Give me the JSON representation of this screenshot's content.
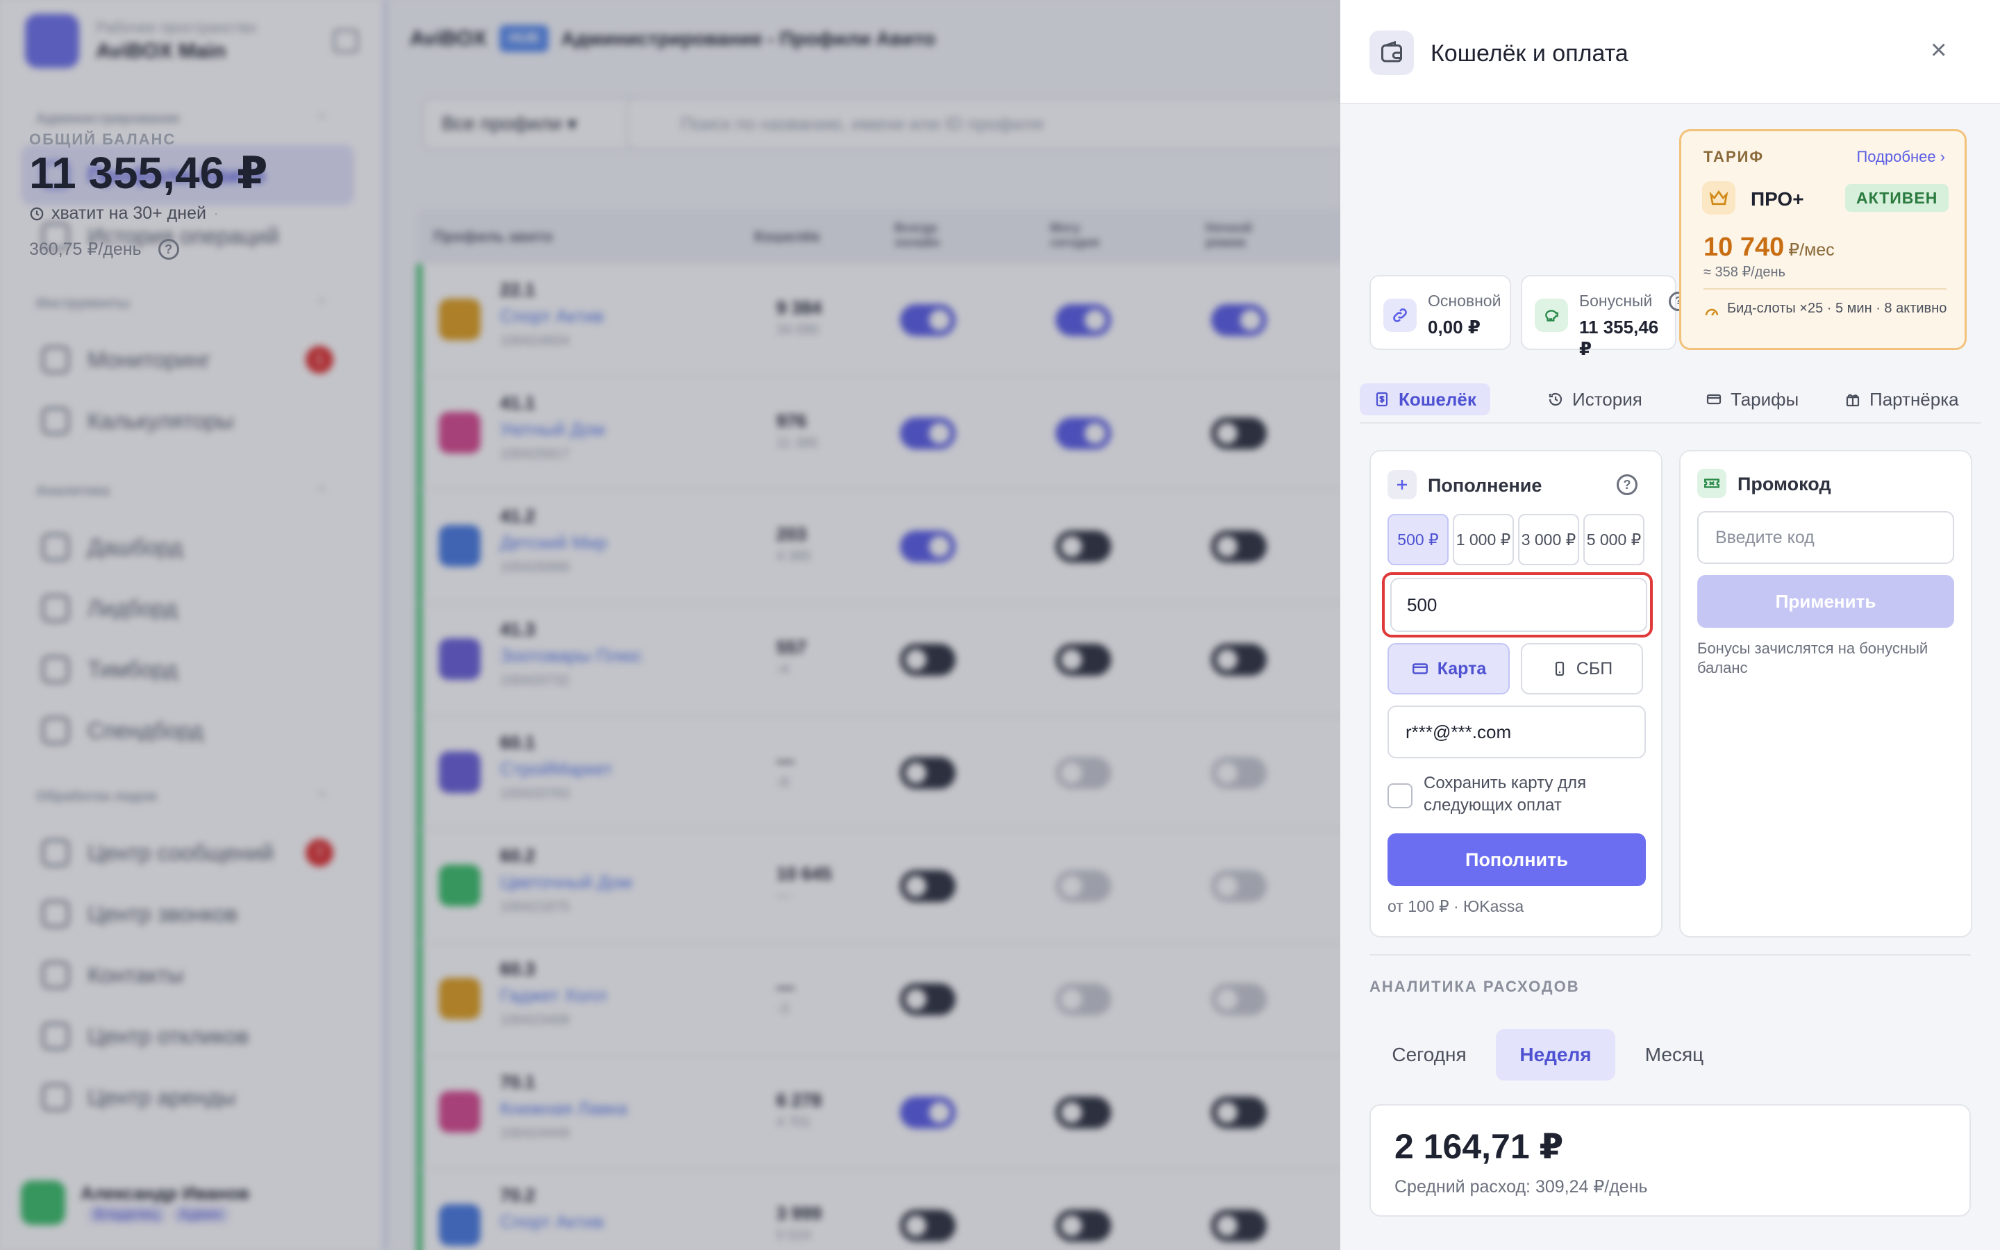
{
  "background": {
    "workspace": {
      "subtitle": "Рабочее пространство",
      "name": "AviBOX Main"
    },
    "sections": [
      {
        "label": "Администрирование",
        "items": [
          {
            "label": "Профили Авито",
            "active": true,
            "badge": ""
          },
          {
            "label": "История операций",
            "active": false,
            "badge": ""
          }
        ]
      },
      {
        "label": "Инструменты",
        "items": [
          {
            "label": "Мониторинг",
            "active": false,
            "badge": "1"
          },
          {
            "label": "Калькуляторы",
            "active": false,
            "badge": ""
          }
        ]
      },
      {
        "label": "Аналитика",
        "items": [
          {
            "label": "Дашборд",
            "active": false,
            "badge": ""
          },
          {
            "label": "Лидборд",
            "active": false,
            "badge": ""
          },
          {
            "label": "Тимборд",
            "active": false,
            "badge": ""
          },
          {
            "label": "Спендборд",
            "active": false,
            "badge": ""
          }
        ]
      },
      {
        "label": "Обработка лидов",
        "items": [
          {
            "label": "Центр сообщений",
            "active": false,
            "badge": "7"
          },
          {
            "label": "Центр звонков",
            "active": false,
            "badge": ""
          },
          {
            "label": "Контакты",
            "active": false,
            "badge": ""
          },
          {
            "label": "Центр откликов",
            "active": false,
            "badge": ""
          },
          {
            "label": "Центр аренды",
            "active": false,
            "badge": ""
          }
        ]
      }
    ],
    "user": {
      "name": "Александр Иванов",
      "role": "Владелец",
      "badge": "Админ"
    },
    "topbar": {
      "brand": "AviBOX",
      "hub": "HUB",
      "breadcrumb": "Администрирование - Профили Авито"
    },
    "filter": "Все профили",
    "search_placeholder": "Поиск по названию, имени или ID профиля",
    "columns": [
      "Профиль авито",
      "Кошелёк",
      "Всегда онлайн",
      "Могу сегодня",
      "Ночной режим"
    ],
    "rows": [
      {
        "num": "22.1",
        "name": "Спорт Актив",
        "id": "100424654",
        "w1": "9 384",
        "w2": "34 090",
        "color": "#e0a020",
        "t": [
          "on",
          "on",
          "on"
        ]
      },
      {
        "num": "41.1",
        "name": "Уютный Дом",
        "id": "100425917",
        "w1": "976",
        "w2": "11 395",
        "color": "#d84a90",
        "t": [
          "on",
          "on",
          "off"
        ]
      },
      {
        "num": "41.2",
        "name": "Детский Мир",
        "id": "100426999",
        "w1": "203",
        "w2": "4 385",
        "color": "#4a7be0",
        "t": [
          "on",
          "off",
          "off"
        ]
      },
      {
        "num": "41.3",
        "name": "Зоотовары Плюс",
        "id": "100420732",
        "w1": "557",
        "w2": "-4",
        "color": "#6a60d8",
        "t": [
          "off",
          "off",
          "off"
        ]
      },
      {
        "num": "60.1",
        "name": "СтройМаркет",
        "id": "100420783",
        "w1": "—",
        "w2": "-8",
        "color": "#6a60d8",
        "t": [
          "off",
          "dim",
          "dim"
        ]
      },
      {
        "num": "60.2",
        "name": "Цветочный Дом",
        "id": "100421875",
        "w1": "10 645",
        "w2": "—",
        "color": "#3cbf6a",
        "t": [
          "off",
          "dim",
          "dim"
        ]
      },
      {
        "num": "60.3",
        "name": "Гаджет Холл",
        "id": "100423408",
        "w1": "—",
        "w2": "-3",
        "color": "#e0a020",
        "t": [
          "off",
          "dim",
          "dim"
        ]
      },
      {
        "num": "70.1",
        "name": "Книжная Лавка",
        "id": "100424449",
        "w1": "6 278",
        "w2": "4 701",
        "color": "#d84a90",
        "t": [
          "on",
          "off",
          "off"
        ]
      },
      {
        "num": "70.2",
        "name": "Спорт Актив",
        "id": "",
        "w1": "3 999",
        "w2": "5 524",
        "color": "#4a7be0",
        "t": [
          "off",
          "off",
          "off"
        ]
      }
    ]
  },
  "panel": {
    "title": "Кошелёк и оплата",
    "close": "×",
    "balance": {
      "label": "ОБЩИЙ БАЛАНС",
      "amount": "11 355,46 ₽",
      "days": "хватит на 30+ дней",
      "days_sep": "·",
      "daily": "360,75 ₽/день"
    },
    "main_balance": {
      "label": "Основной",
      "value": "0,00 ₽"
    },
    "bonus_balance": {
      "label": "Бонусный",
      "value": "11 355,46 ₽"
    },
    "tariff": {
      "label": "ТАРИФ",
      "more": "Подробнее ›",
      "plan": "ПРО+",
      "status": "АКТИВЕН",
      "price": "10 740",
      "price_unit": "₽/мес",
      "per_day": "≈ 358 ₽/день",
      "note": "Бид-слоты ×25 · 5 мин · 8 активно"
    },
    "tabs": [
      "Кошелёк",
      "История",
      "Тарифы",
      "Партнёрка"
    ],
    "topup": {
      "title": "Пополнение",
      "amounts": [
        "500 ₽",
        "1 000 ₽",
        "3 000 ₽",
        "5 000 ₽"
      ],
      "value": "500",
      "methods": [
        "Карта",
        "СБП"
      ],
      "email": "r***@***.com",
      "save_card": "Сохранить карту для следующих оплат",
      "button": "Пополнить",
      "note": "от 100 ₽ · ЮKassa"
    },
    "promo": {
      "title": "Промокод",
      "placeholder": "Введите код",
      "button": "Применить",
      "note": "Бонусы зачислятся на бонусный баланс"
    },
    "analytics": {
      "label": "АНАЛИТИКА РАСХОДОВ",
      "periods": [
        "Сегодня",
        "Неделя",
        "Месяц"
      ],
      "active_period": "Неделя",
      "amount": "2 164,71 ₽",
      "avg": "Средний расход: 309,24 ₽/день"
    },
    "colors": {
      "accent": "#6b6ef0",
      "highlight": "#e0393a",
      "tariff_border": "#f2c27b",
      "price": "#c86d12"
    }
  }
}
